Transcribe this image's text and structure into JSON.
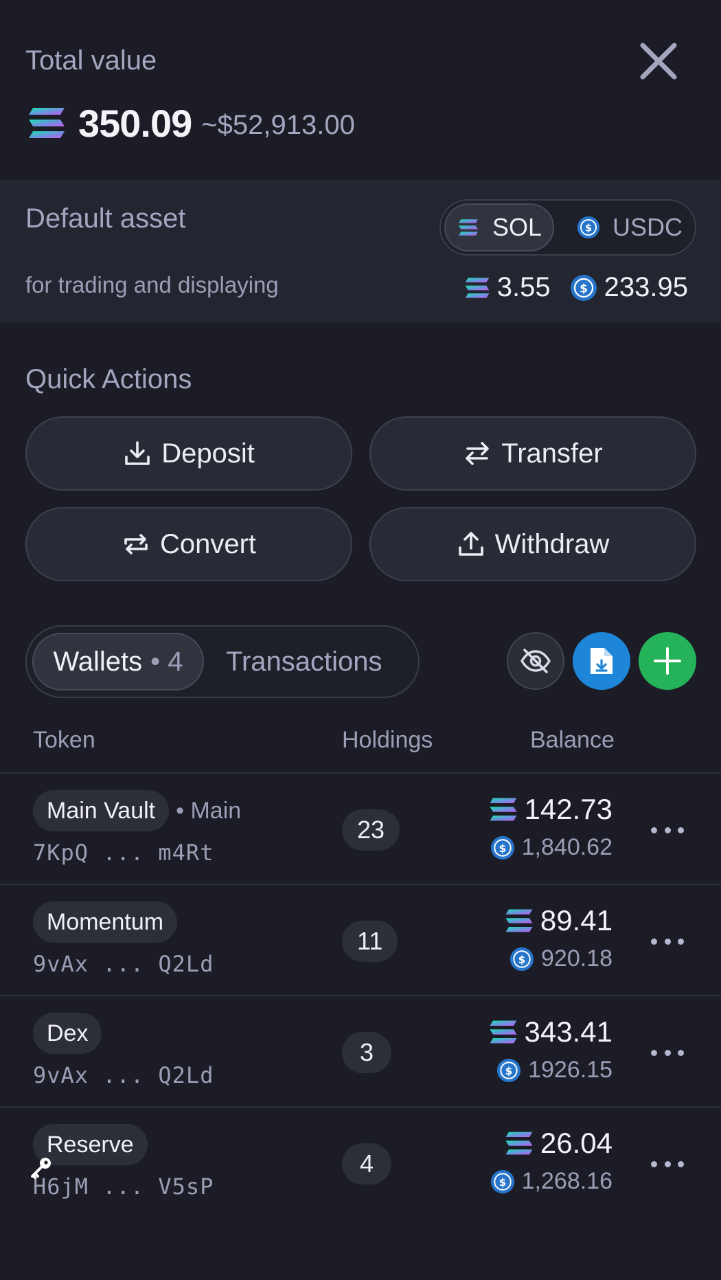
{
  "header": {
    "title": "Total value",
    "amount": "350.09",
    "usd": "~$52,913.00"
  },
  "default_asset": {
    "title": "Default asset",
    "subtitle": "for trading and displaying",
    "options": [
      {
        "label": "SOL",
        "selected": true
      },
      {
        "label": "USDC",
        "selected": false
      }
    ],
    "sol_balance": "3.55",
    "usdc_balance": "233.95"
  },
  "quick_actions": {
    "title": "Quick Actions",
    "deposit": "Deposit",
    "transfer": "Transfer",
    "convert": "Convert",
    "withdraw": "Withdraw"
  },
  "tabs": {
    "wallets_label": "Wallets",
    "wallets_count": "• 4",
    "transactions_label": "Transactions"
  },
  "table": {
    "headers": {
      "token": "Token",
      "holdings": "Holdings",
      "balance": "Balance"
    },
    "rows": [
      {
        "name": "Main Vault",
        "tag": "• Main",
        "address": "7KpQ ... m4Rt",
        "holdings": "23",
        "sol": "142.73",
        "usdc": "1,840.62"
      },
      {
        "name": "Momentum",
        "tag": "",
        "address": "9vAx ... Q2Ld",
        "holdings": "11",
        "sol": "89.41",
        "usdc": "920.18"
      },
      {
        "name": "Dex",
        "tag": "",
        "address": "9vAx ... Q2Ld",
        "holdings": "3",
        "sol": "343.41",
        "usdc": "1926.15"
      },
      {
        "name": "Reserve",
        "tag": "",
        "address": "H6jM ... V5sP",
        "holdings": "4",
        "sol": "26.04",
        "usdc": "1,268.16"
      }
    ]
  },
  "icons": {
    "close": "close-icon",
    "sol": "solana-icon",
    "usdc": "usdc-icon",
    "deposit": "download-icon",
    "transfer": "arrows-left-right-icon",
    "convert": "repeat-icon",
    "withdraw": "upload-icon",
    "hide": "eye-off-icon",
    "export": "file-download-icon",
    "add": "plus-icon",
    "more": "more-horizontal-icon",
    "key": "key-icon"
  },
  "colors": {
    "background": "#1b1c26",
    "band": "#232631",
    "export_button": "#1e86d8",
    "add_button": "#25b35a",
    "usdc": "#2775ca"
  }
}
